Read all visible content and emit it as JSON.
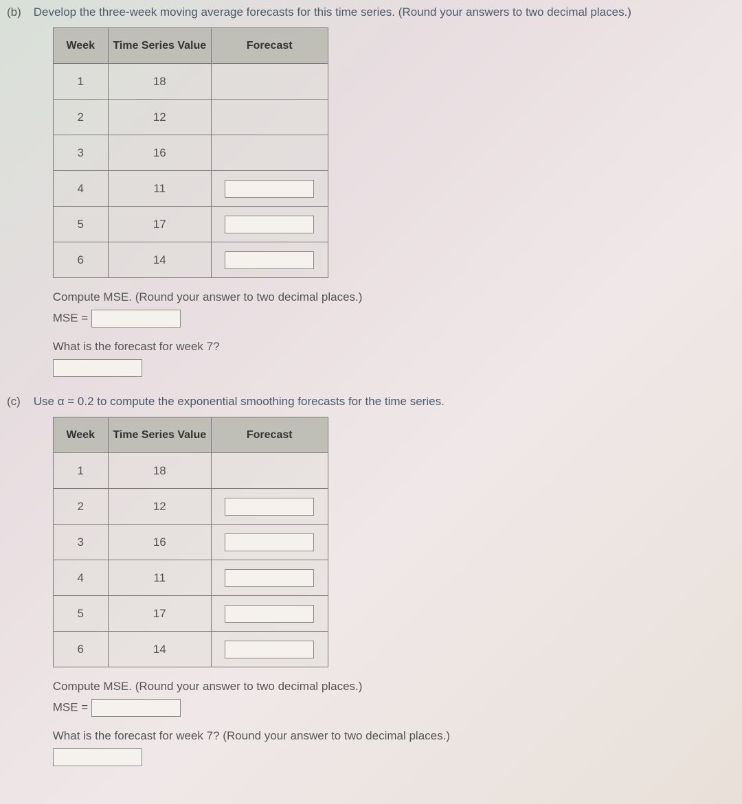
{
  "partB": {
    "label": "(b)",
    "prompt": "Develop the three-week moving average forecasts for this time series. (Round your answers to two decimal places.)",
    "headers": {
      "week": "Week",
      "tsv": "Time Series Value",
      "forecast": "Forecast"
    },
    "rows": [
      {
        "week": "1",
        "value": "18",
        "hasForecast": false
      },
      {
        "week": "2",
        "value": "12",
        "hasForecast": false
      },
      {
        "week": "3",
        "value": "16",
        "hasForecast": false
      },
      {
        "week": "4",
        "value": "11",
        "hasForecast": true
      },
      {
        "week": "5",
        "value": "17",
        "hasForecast": true
      },
      {
        "week": "6",
        "value": "14",
        "hasForecast": true
      }
    ],
    "computeMse": "Compute MSE. (Round your answer to two decimal places.)",
    "mseLabel": "MSE =",
    "week7Prompt": "What is the forecast for week 7?"
  },
  "partC": {
    "label": "(c)",
    "prompt": "Use α = 0.2 to compute the exponential smoothing forecasts for the time series.",
    "headers": {
      "week": "Week",
      "tsv": "Time Series Value",
      "forecast": "Forecast"
    },
    "rows": [
      {
        "week": "1",
        "value": "18",
        "hasForecast": false
      },
      {
        "week": "2",
        "value": "12",
        "hasForecast": true
      },
      {
        "week": "3",
        "value": "16",
        "hasForecast": true
      },
      {
        "week": "4",
        "value": "11",
        "hasForecast": true
      },
      {
        "week": "5",
        "value": "17",
        "hasForecast": true
      },
      {
        "week": "6",
        "value": "14",
        "hasForecast": true
      }
    ],
    "computeMse": "Compute MSE. (Round your answer to two decimal places.)",
    "mseLabel": "MSE =",
    "week7Prompt": "What is the forecast for week 7? (Round your answer to two decimal places.)"
  }
}
